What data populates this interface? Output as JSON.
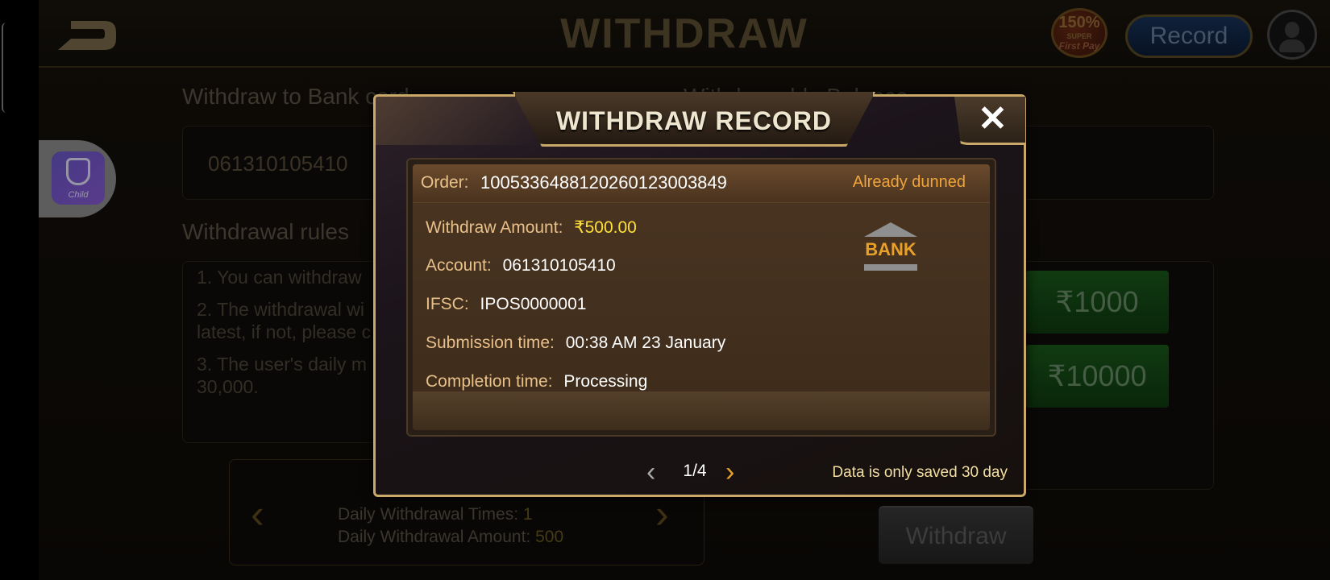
{
  "header": {
    "title": "WITHDRAW",
    "record_label": "Record",
    "promo": {
      "percent": "150%",
      "super": "SUPER",
      "first_pay": "First Pay"
    }
  },
  "background": {
    "withdraw_to_label": "Withdraw to Bank card",
    "withdrawable_label": "Withdrawable Balance",
    "account_number": "061310105410",
    "rules_title": "Withdrawal rules",
    "rules": [
      "1. You can withdraw",
      "2. The withdrawal wi latest, if not, please c",
      "3. The user's daily m 30,000."
    ],
    "amount_options": [
      "₹1000",
      "₹10000"
    ],
    "daily_times_label": "Daily Withdrawal Times:",
    "daily_times_value": "1",
    "daily_amount_label": "Daily Withdrawal Amount:",
    "daily_amount_value": "500",
    "withdraw_button": "Withdraw",
    "child_app_label": "Child"
  },
  "modal": {
    "title": "WITHDRAW RECORD",
    "close_label": "✕",
    "record": {
      "order_label": "Order:",
      "order_number": "10053364881202601230038​49",
      "status": "Already dunned",
      "withdraw_amount_label": "Withdraw Amount:",
      "withdraw_amount_value": "₹500.00",
      "account_label": "Account:",
      "account_value": "061310105410",
      "ifsc_label": "IFSC:",
      "ifsc_value": "IPOS0000001",
      "submission_label": "Submission time:",
      "submission_value": "00:38 AM 23 January",
      "completion_label": "Completion time:",
      "completion_value": "Processing",
      "bank_icon_label": "BANK"
    },
    "pagination": {
      "current_page": 1,
      "total_pages": 4,
      "text": "1/4",
      "prev_glyph": "‹",
      "next_glyph": "›"
    },
    "note": "Data is only saved 30 day"
  }
}
